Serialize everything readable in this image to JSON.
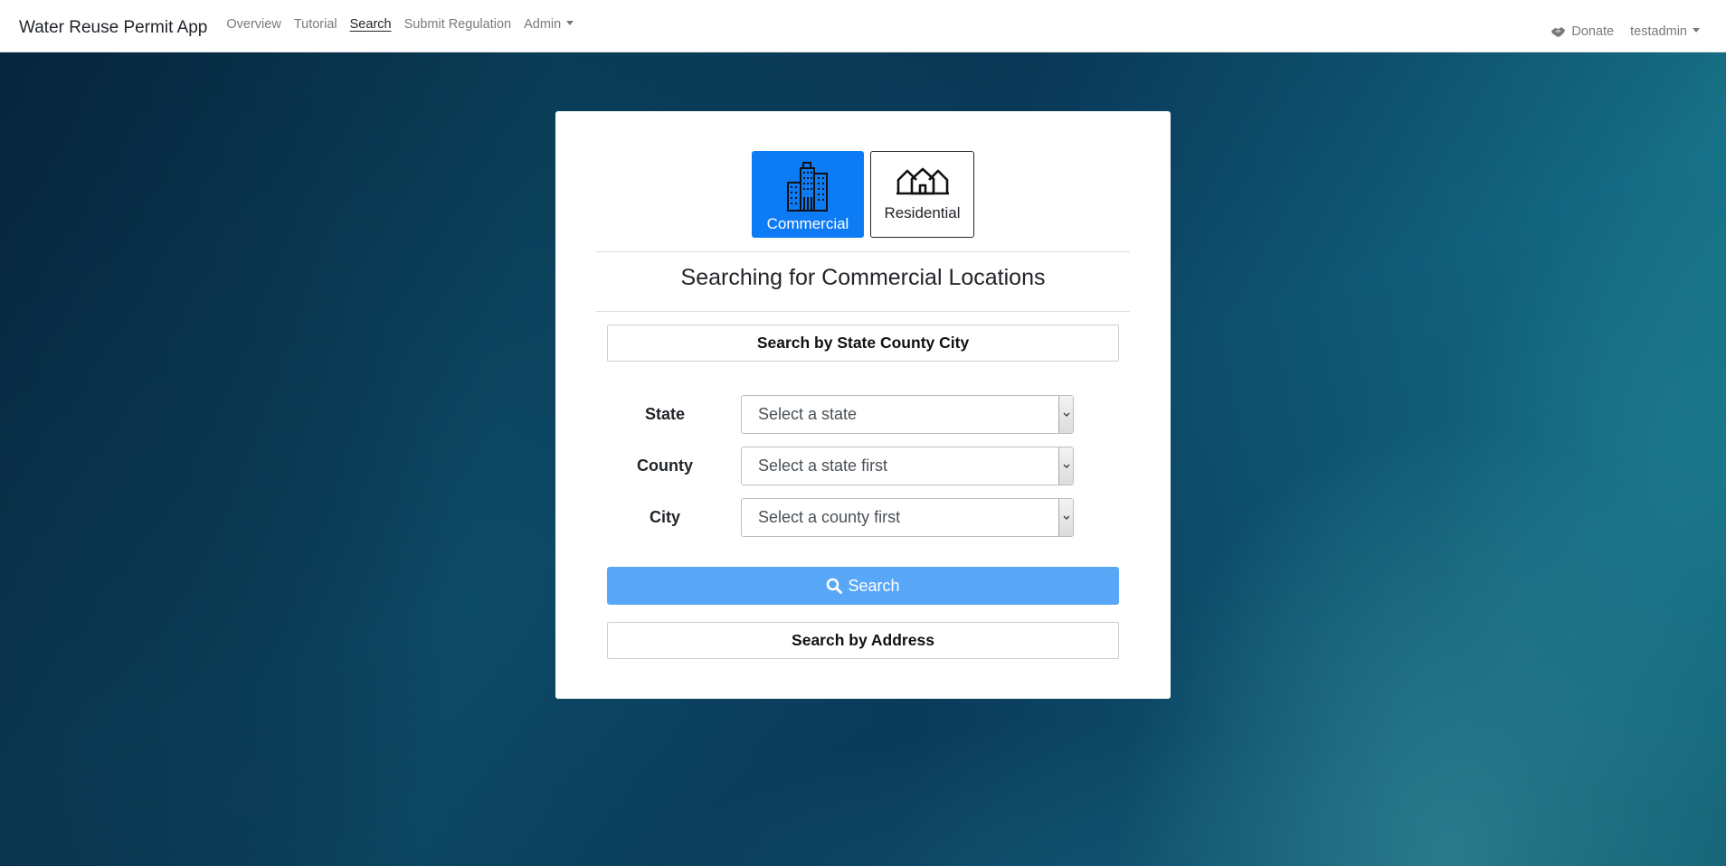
{
  "navbar": {
    "brand": "Water Reuse Permit App",
    "links": [
      {
        "label": "Overview"
      },
      {
        "label": "Tutorial"
      },
      {
        "label": "Search"
      },
      {
        "label": "Submit Regulation"
      },
      {
        "label": "Admin"
      }
    ],
    "donate_label": "Donate",
    "user_label": "testadmin",
    "donate_icon": "handshake-icon"
  },
  "search_card": {
    "types": [
      {
        "label": "Commercial",
        "icon": "buildings-icon",
        "selected": true
      },
      {
        "label": "Residential",
        "icon": "houses-icon",
        "selected": false
      }
    ],
    "heading": "Searching for Commercial Locations",
    "by_region_label": "Search by State County City",
    "fields": [
      {
        "label": "State",
        "value": "Select a state"
      },
      {
        "label": "County",
        "value": "Select a state first"
      },
      {
        "label": "City",
        "value": "Select a county first"
      }
    ],
    "search_button_label": "Search",
    "by_address_label": "Search by Address"
  },
  "colors": {
    "primary": "#0d7bf4",
    "search_button": "#58a8f7"
  }
}
